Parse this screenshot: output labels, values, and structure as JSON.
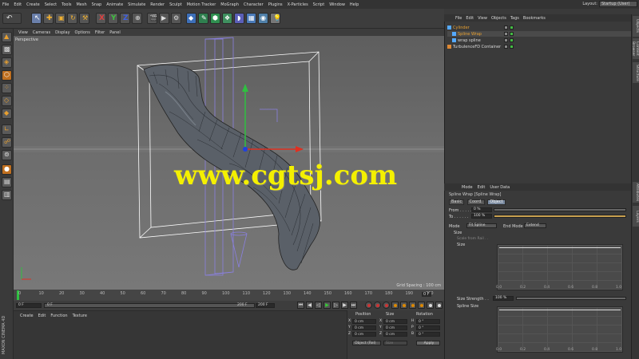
{
  "menubar": {
    "items": [
      "File",
      "Edit",
      "Create",
      "Select",
      "Tools",
      "Mesh",
      "Snap",
      "Animate",
      "Simulate",
      "Render",
      "Sculpt",
      "Motion Tracker",
      "MoGraph",
      "Character",
      "Plugins",
      "X-Particles",
      "Script",
      "Window",
      "Help"
    ],
    "layout_label": "Layout:",
    "layout_value": "Startup (User)"
  },
  "viewport": {
    "menu": [
      "View",
      "Cameras",
      "Display",
      "Options",
      "Filter",
      "Panel"
    ],
    "label": "Perspective",
    "grid_spacing": "Grid Spacing : 100 cm"
  },
  "timeline": {
    "ticks": [
      "0",
      "10",
      "20",
      "30",
      "40",
      "50",
      "60",
      "70",
      "80",
      "90",
      "100",
      "110",
      "120",
      "130",
      "140",
      "150",
      "160",
      "170",
      "180",
      "190",
      "200"
    ],
    "current": "0 F",
    "field_start": "0 F",
    "field_min": "0 F",
    "field_max": "200 F",
    "field_end": "200 F",
    "right_field": "0 F"
  },
  "material": {
    "menu": [
      "Create",
      "Edit",
      "Function",
      "Texture"
    ],
    "brand": "MAXON CINEMA 4D"
  },
  "coords": {
    "headers": [
      "Position",
      "Size",
      "Rotation"
    ],
    "rows": [
      {
        "axis": "X",
        "pos": "0 cm",
        "size": "0 cm",
        "rot_label": "H",
        "rot": "0 °"
      },
      {
        "axis": "Y",
        "pos": "0 cm",
        "size": "0 cm",
        "rot_label": "P",
        "rot": "0 °"
      },
      {
        "axis": "Z",
        "pos": "0 cm",
        "size": "0 cm",
        "rot_label": "B",
        "rot": "0 °"
      }
    ],
    "mode": "Object (Rel)",
    "size_mode": "Size",
    "apply": "Apply"
  },
  "objects": {
    "menu": [
      "File",
      "Edit",
      "View",
      "Objects",
      "Tags",
      "Bookmarks"
    ],
    "rows": [
      {
        "name": "Cylinder",
        "level": 0,
        "color": "#e8a030"
      },
      {
        "name": "Spline Wrap",
        "level": 1,
        "color": "#e8a030"
      },
      {
        "name": "wrap spline",
        "level": 1,
        "color": "#d8d8d8"
      },
      {
        "name": "TurbulenceFD Container",
        "level": 0,
        "color": "#d8d8d8"
      }
    ]
  },
  "attributes": {
    "menu": [
      "Mode",
      "Edit",
      "User Data"
    ],
    "title": "Spline Wrap [Spline Wrap]",
    "tabs": [
      "Basic",
      "Coord.",
      "Object"
    ],
    "active_tab": "Object",
    "from_label": "From . . . . .",
    "from_value": "0 %",
    "to_label": "To . . . . . .",
    "to_value": "100 %",
    "mode_label": "Mode",
    "mode_value": "Fit Spline",
    "end_mode_label": "End Mode",
    "end_mode_value": "Extend",
    "size_section": "Size",
    "scale_from_rail": "Scale from Rail . .",
    "size_label": "Size",
    "size_strength_label": "Size Strength . .",
    "size_strength_value": "100 %",
    "spline_size_label": "Spline Size",
    "graph_ticks": [
      "0.0",
      "0.2",
      "0.4",
      "0.6",
      "0.8",
      "1.0"
    ]
  },
  "sidetabs": [
    "Objects",
    "Content Browser",
    "Structure",
    "Attributes",
    "Layers"
  ],
  "watermark": "www.cgtsj.com",
  "colors": {
    "accent": "#7a8aa0",
    "watermark": "#f4f000",
    "object_highlight": "#e8a030",
    "axis_y": "#2fc040",
    "axis_x": "#e03020",
    "axis_z": "#2040e0"
  }
}
